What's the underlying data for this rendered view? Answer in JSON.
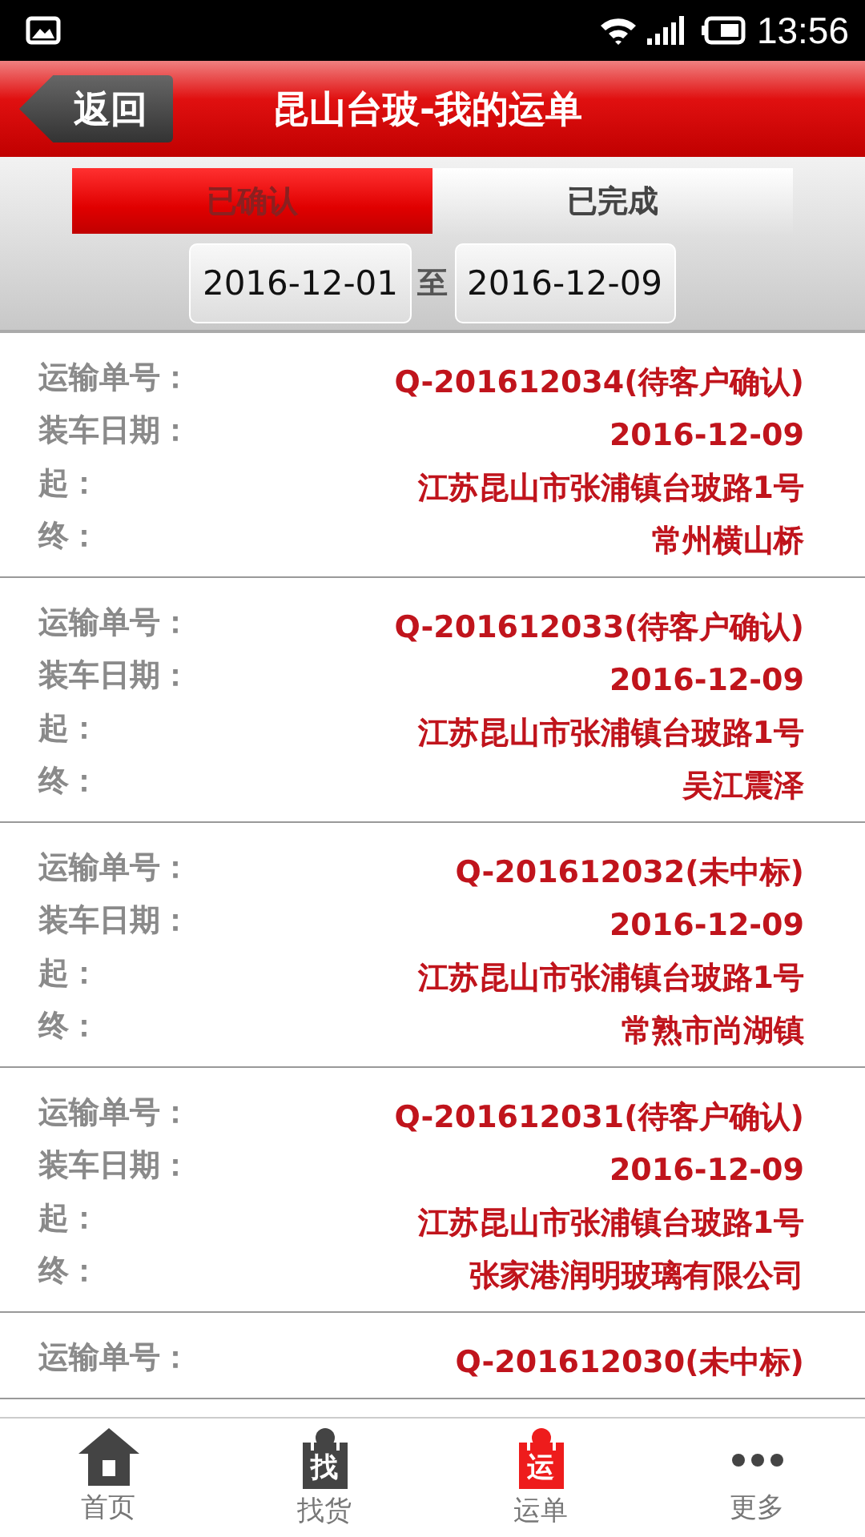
{
  "status_bar": {
    "time": "13:56"
  },
  "header": {
    "back": "返回",
    "title": "昆山台玻-我的运单"
  },
  "tabs": [
    {
      "label": "已确认",
      "selected": true
    },
    {
      "label": "已完成",
      "selected": false
    }
  ],
  "date_range": {
    "from": "2016-12-01",
    "separator": "至",
    "to": "2016-12-09"
  },
  "orders": [
    {
      "fields": [
        {
          "label": "运输单号：",
          "value": "Q-201612034(待客户确认)"
        },
        {
          "label": "装车日期：",
          "value": "2016-12-09"
        },
        {
          "label": "起：",
          "value": "江苏昆山市张浦镇台玻路1号"
        },
        {
          "label": "终：",
          "value": "常州横山桥"
        }
      ]
    },
    {
      "fields": [
        {
          "label": "运输单号：",
          "value": "Q-201612033(待客户确认)"
        },
        {
          "label": "装车日期：",
          "value": "2016-12-09"
        },
        {
          "label": "起：",
          "value": "江苏昆山市张浦镇台玻路1号"
        },
        {
          "label": "终：",
          "value": "吴江震泽"
        }
      ]
    },
    {
      "fields": [
        {
          "label": "运输单号：",
          "value": "Q-201612032(未中标)"
        },
        {
          "label": "装车日期：",
          "value": "2016-12-09"
        },
        {
          "label": "起：",
          "value": "江苏昆山市张浦镇台玻路1号"
        },
        {
          "label": "终：",
          "value": "常熟市尚湖镇"
        }
      ]
    },
    {
      "fields": [
        {
          "label": "运输单号：",
          "value": "Q-201612031(待客户确认)"
        },
        {
          "label": "装车日期：",
          "value": "2016-12-09"
        },
        {
          "label": "起：",
          "value": "江苏昆山市张浦镇台玻路1号"
        },
        {
          "label": "终：",
          "value": "张家港润明玻璃有限公司"
        }
      ]
    },
    {
      "fields": [
        {
          "label": "运输单号：",
          "value": "Q-201612030(未中标)"
        }
      ]
    }
  ],
  "nav": [
    {
      "kind": "home",
      "label": "首页",
      "selected": false
    },
    {
      "kind": "bag",
      "icon_text": "找",
      "label": "找货",
      "selected": false
    },
    {
      "kind": "bag",
      "icon_text": "运",
      "label": "运单",
      "selected": true
    },
    {
      "kind": "more",
      "label": "更多",
      "selected": false
    }
  ]
}
